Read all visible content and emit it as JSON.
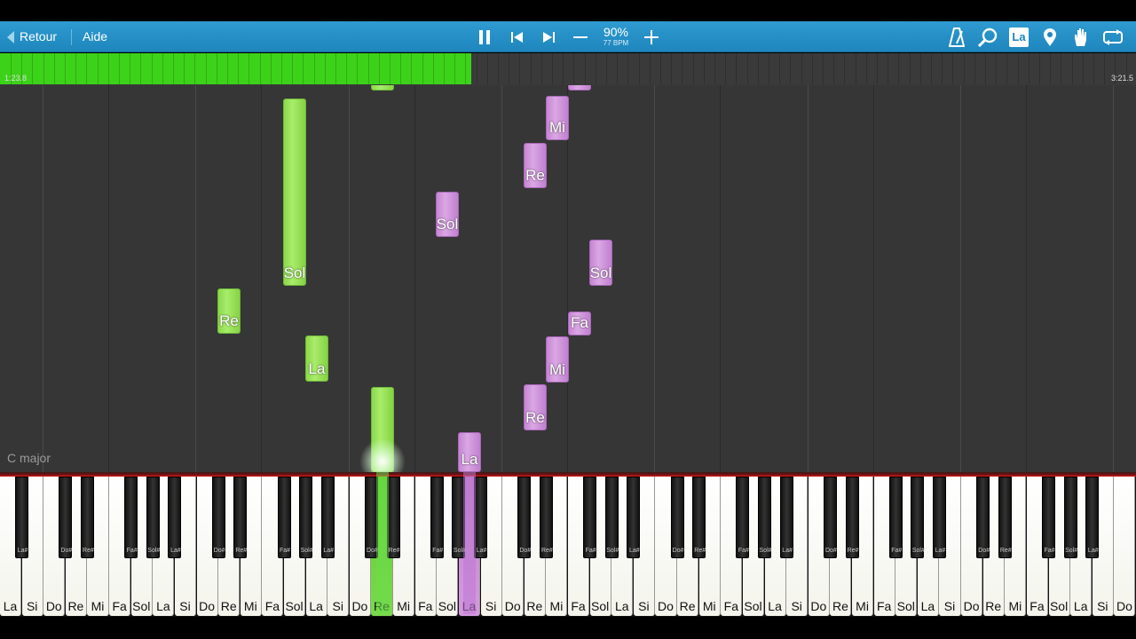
{
  "toolbar": {
    "back_label": "Retour",
    "help_label": "Aide",
    "speed_percent": "90%",
    "tempo": "77 BPM",
    "note_names_label": "La",
    "icons": [
      "pause-icon",
      "previous-icon",
      "next-icon",
      "minus-icon",
      "plus-icon",
      "metronome-icon",
      "zoom-icon",
      "note-names-icon",
      "marker-icon",
      "hand-icon",
      "loop-icon"
    ]
  },
  "progress": {
    "current_time": "1:23.8",
    "total_time": "3:21.5",
    "fraction": 0.415,
    "color": "#3cd219"
  },
  "key_signature": "C major",
  "colors": {
    "right_hand": "#9fe35f",
    "left_hand": "#d59be0",
    "toolbar": "#2592c8"
  },
  "notes": [
    {
      "label": "Sol",
      "hand": "right"
    },
    {
      "label": "Re",
      "hand": "right"
    },
    {
      "label": "La",
      "hand": "right"
    },
    {
      "label": "",
      "hand": "right"
    },
    {
      "label": "",
      "hand": "right"
    },
    {
      "label": "Mi",
      "hand": "left"
    },
    {
      "label": "",
      "hand": "left"
    },
    {
      "label": "Re",
      "hand": "left"
    },
    {
      "label": "Sol",
      "hand": "left"
    },
    {
      "label": "Sol",
      "hand": "left"
    },
    {
      "label": "Fa",
      "hand": "left"
    },
    {
      "label": "Mi",
      "hand": "left"
    },
    {
      "label": "Re",
      "hand": "left"
    },
    {
      "label": "La",
      "hand": "left"
    }
  ],
  "keyboard": {
    "white_keys": [
      "La",
      "Si",
      "Do",
      "Re",
      "Mi",
      "Fa",
      "Sol",
      "La",
      "Si",
      "Do",
      "Re",
      "Mi",
      "Fa",
      "Sol",
      "La",
      "Si",
      "Do",
      "Re",
      "Mi",
      "Fa",
      "Sol",
      "La",
      "Si",
      "Do",
      "Re",
      "Mi",
      "Fa",
      "Sol",
      "La",
      "Si",
      "Do",
      "Re",
      "Mi",
      "Fa",
      "Sol",
      "La",
      "Si",
      "Do",
      "Re",
      "Mi",
      "Fa",
      "Sol",
      "La",
      "Si",
      "Do",
      "Re",
      "Mi",
      "Fa",
      "Sol",
      "La",
      "Si",
      "Do"
    ],
    "black_key_labels": {
      "after_La": "La#",
      "after_Do": "Do#",
      "after_Re": "Re#",
      "after_Fa": "Fa#",
      "after_Sol": "Sol#"
    },
    "pressed_white": [
      {
        "index": 17,
        "hand": "right"
      },
      {
        "index": 21,
        "hand": "left"
      }
    ]
  }
}
